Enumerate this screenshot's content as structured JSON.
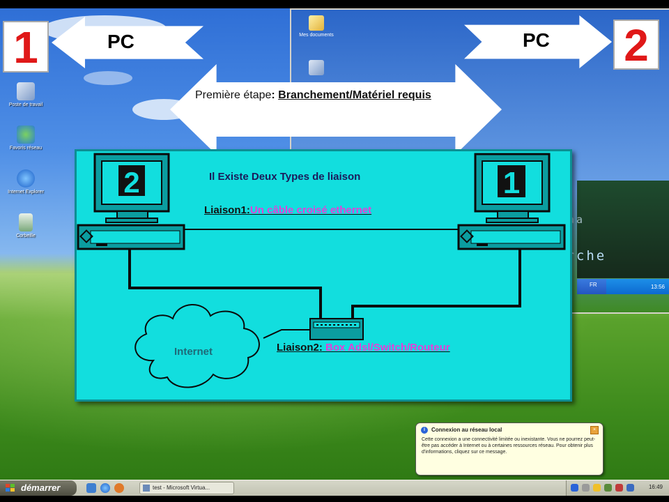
{
  "desktop_icons": [
    {
      "label": "Poste de travail",
      "icon": "my-computer-icon"
    },
    {
      "label": "Favoris réseau",
      "icon": "network-places-icon"
    },
    {
      "label": "Internet Explorer",
      "icon": "internet-explorer-icon"
    },
    {
      "label": "Corbeille",
      "icon": "recycle-bin-icon"
    }
  ],
  "vm2": {
    "icons": [
      {
        "label": "Mes documents",
        "icon": "my-documents-icon"
      },
      {
        "label": "",
        "icon": "my-computer-icon"
      }
    ],
    "lang": "FR",
    "clock": "13:56",
    "watermark_top": "maa",
    "watermark": "arche"
  },
  "arrows": {
    "left": {
      "label": "PC",
      "badge": "1"
    },
    "right": {
      "label": "PC",
      "badge": "2"
    },
    "center": {
      "prefix": "Première étape",
      "colon": ": ",
      "title": "Branchement/Matériel requis"
    }
  },
  "slide": {
    "title": "Il Existe Deux Types de liaison",
    "liaison1_label": "Liaison1:",
    "liaison1_value": "Un câble croisé ethernet",
    "liaison2_label": "Liaison2:",
    "liaison2_value": " Box Adsl/Switch/Routeur",
    "cloud_label": "Internet",
    "monitor_left_number": "2",
    "monitor_right_number": "1"
  },
  "balloon": {
    "title": "Connexion au réseau local",
    "body": "Cette connexion a une connectivité limitée ou inexistante. Vous ne pourrez peut-être pas accéder à Internet ou à certaines ressources réseau. Pour obtenir plus d'informations, cliquez sur ce message."
  },
  "taskbar": {
    "start_label": "démarrer",
    "task_label": "test - Microsoft Virtua...",
    "clock": "16:49"
  },
  "colors": {
    "slide_bg": "#12dede",
    "badge_red": "#e01818",
    "link_pink": "#e43fd8"
  }
}
